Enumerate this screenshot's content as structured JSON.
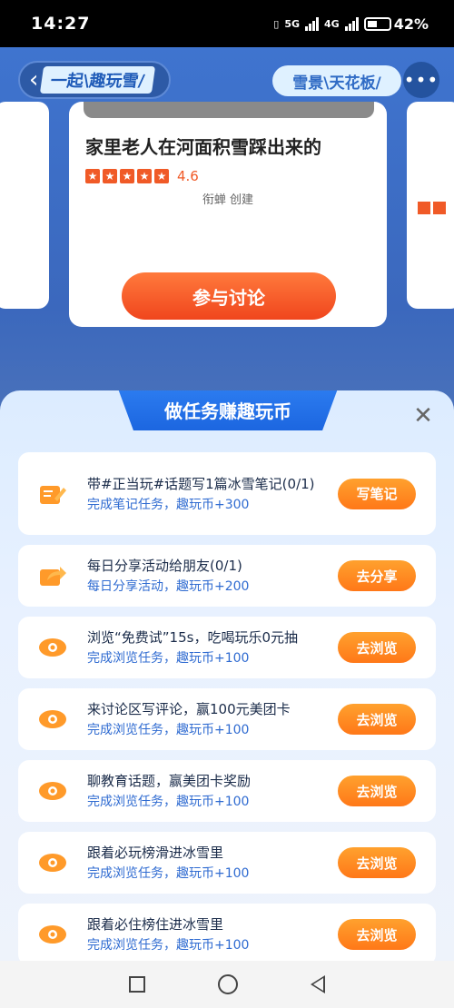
{
  "status_bar": {
    "time": "14:27",
    "network_1": "5G",
    "network_2": "4G",
    "battery": "42%"
  },
  "header": {
    "title": "一起\\趣玩雪/",
    "tag": "雪景\\天花板/",
    "more": "•••"
  },
  "card": {
    "title": "家里老人在河面积雪踩出来的",
    "score": "4.6",
    "creator": "衔蝉 创建",
    "join_label": "参与讨论"
  },
  "sheet": {
    "title": "做任务赚趣玩币",
    "close": "✕",
    "tasks": [
      {
        "title": "带#正当玩#话题写1篇冰雪笔记(0/1)",
        "desc": "完成笔记任务，趣玩币+300",
        "button": "写笔记",
        "icon": "note-edit-icon"
      },
      {
        "title": "每日分享活动给朋友(0/1)",
        "desc": "每日分享活动，趣玩币+200",
        "button": "去分享",
        "icon": "share-icon"
      },
      {
        "title": "浏览“免费试”15s，吃喝玩乐0元抽",
        "desc": "完成浏览任务，趣玩币+100",
        "button": "去浏览",
        "icon": "eye-icon"
      },
      {
        "title": "来讨论区写评论，赢100元美团卡",
        "desc": "完成浏览任务，趣玩币+100",
        "button": "去浏览",
        "icon": "eye-icon"
      },
      {
        "title": "聊教育话题，赢美团卡奖励",
        "desc": "完成浏览任务，趣玩币+100",
        "button": "去浏览",
        "icon": "eye-icon"
      },
      {
        "title": "跟着必玩榜滑进冰雪里",
        "desc": "完成浏览任务，趣玩币+100",
        "button": "去浏览",
        "icon": "eye-icon"
      },
      {
        "title": "跟着必住榜住进冰雪里",
        "desc": "完成浏览任务，趣玩币+100",
        "button": "去浏览",
        "icon": "eye-icon"
      }
    ]
  },
  "colors": {
    "accent_blue": "#1c66e0",
    "button_orange": "#ff7818",
    "desc_blue": "#2f6bd1"
  }
}
